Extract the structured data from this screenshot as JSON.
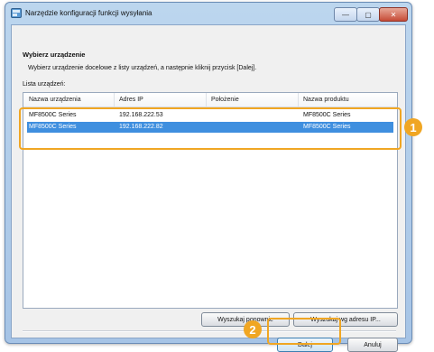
{
  "window": {
    "title": "Narzędzie konfiguracji funkcji wysyłania",
    "minimize_label": "—",
    "maximize_label": "▢",
    "close_label": "✕"
  },
  "main": {
    "heading": "Wybierz urządzenie",
    "instruction": "Wybierz urządzenie docelowe z listy urządzeń, a następnie kliknij przycisk [Dalej].",
    "list_label": "Lista urządzeń:",
    "columns": [
      "Nazwa urządzenia",
      "Adres IP",
      "Położenie",
      "Nazwa produktu"
    ],
    "rows": [
      {
        "name": "MF8500C Series",
        "ip": "192.168.222.53",
        "location": "",
        "product": "MF8500C Series",
        "selected": false
      },
      {
        "name": "MF8500C Series",
        "ip": "192.168.222.82",
        "location": "",
        "product": "MF8500C Series",
        "selected": true
      }
    ]
  },
  "buttons": {
    "search_again": "Wyszukaj ponownie",
    "search_by_ip": "Wyszukaj wg adresu IP...",
    "next": "Dalej",
    "cancel": "Anuluj"
  },
  "callouts": [
    "1",
    "2"
  ],
  "colors": {
    "accent": "#f0a623",
    "selection": "#3f8fdf"
  }
}
